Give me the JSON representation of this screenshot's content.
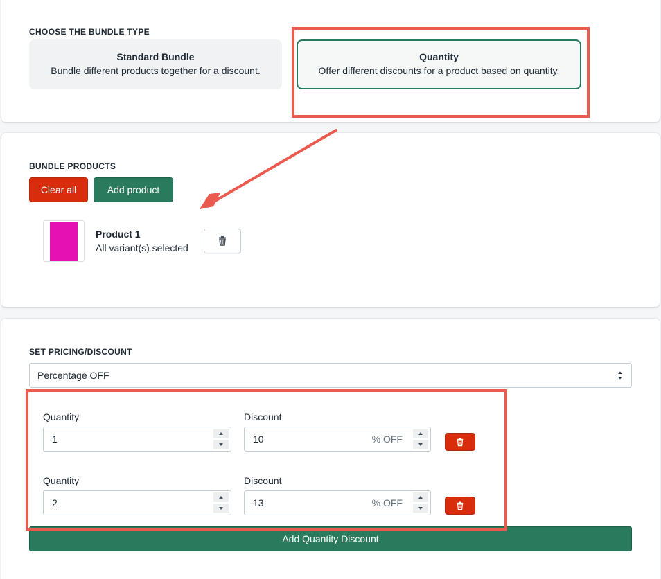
{
  "bundle_type": {
    "title": "CHOOSE THE BUNDLE TYPE",
    "options": [
      {
        "title": "Standard Bundle",
        "description": "Bundle different products together for a discount."
      },
      {
        "title": "Quantity",
        "description": "Offer different discounts for a product based on quantity.",
        "selected": true
      }
    ]
  },
  "bundle_products": {
    "title": "BUNDLE PRODUCTS",
    "clear_label": "Clear all",
    "add_label": "Add product",
    "products": [
      {
        "name": "Product 1",
        "variants": "All variant(s) selected"
      }
    ]
  },
  "pricing": {
    "title": "SET PRICING/DISCOUNT",
    "select_value": "Percentage OFF",
    "rows": [
      {
        "quantity_label": "Quantity",
        "quantity": "1",
        "discount_label": "Discount",
        "discount": "10",
        "suffix": "% OFF"
      },
      {
        "quantity_label": "Quantity",
        "quantity": "2",
        "discount_label": "Discount",
        "discount": "13",
        "suffix": "% OFF"
      }
    ],
    "add_discount_label": "Add Quantity Discount"
  },
  "colors": {
    "primary_green": "#2a7a5e",
    "destructive_red": "#d82c0d",
    "annotation_red": "#ea5a4f",
    "product_thumb": "#e611b2"
  }
}
